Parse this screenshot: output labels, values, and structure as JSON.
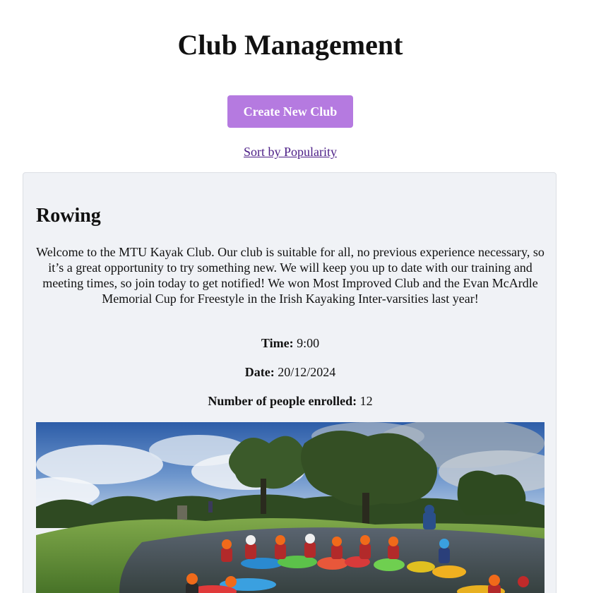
{
  "header": {
    "title": "Club Management"
  },
  "actions": {
    "create_label": "Create New Club",
    "sort_label": "Sort by Popularity"
  },
  "club": {
    "name": "Rowing",
    "description": "Welcome to the MTU Kayak Club. Our club is suitable for all, no previous experience necessary, so it’s a great opportunity to try something new. We will keep you up to date with our training and meeting times, so join today to get notified! We won Most Improved Club and the Evan McArdle Memorial Cup for Freestyle in the Irish Kayaking Inter-varsities last year!",
    "time_label": "Time:",
    "time_value": "9:00",
    "date_label": "Date:",
    "date_value": "20/12/2024",
    "enrolled_label": "Number of people enrolled:",
    "enrolled_value": "12"
  },
  "colors": {
    "button_bg": "#b57ae0",
    "link": "#4b1d86",
    "card_bg": "#f0f2f6"
  }
}
